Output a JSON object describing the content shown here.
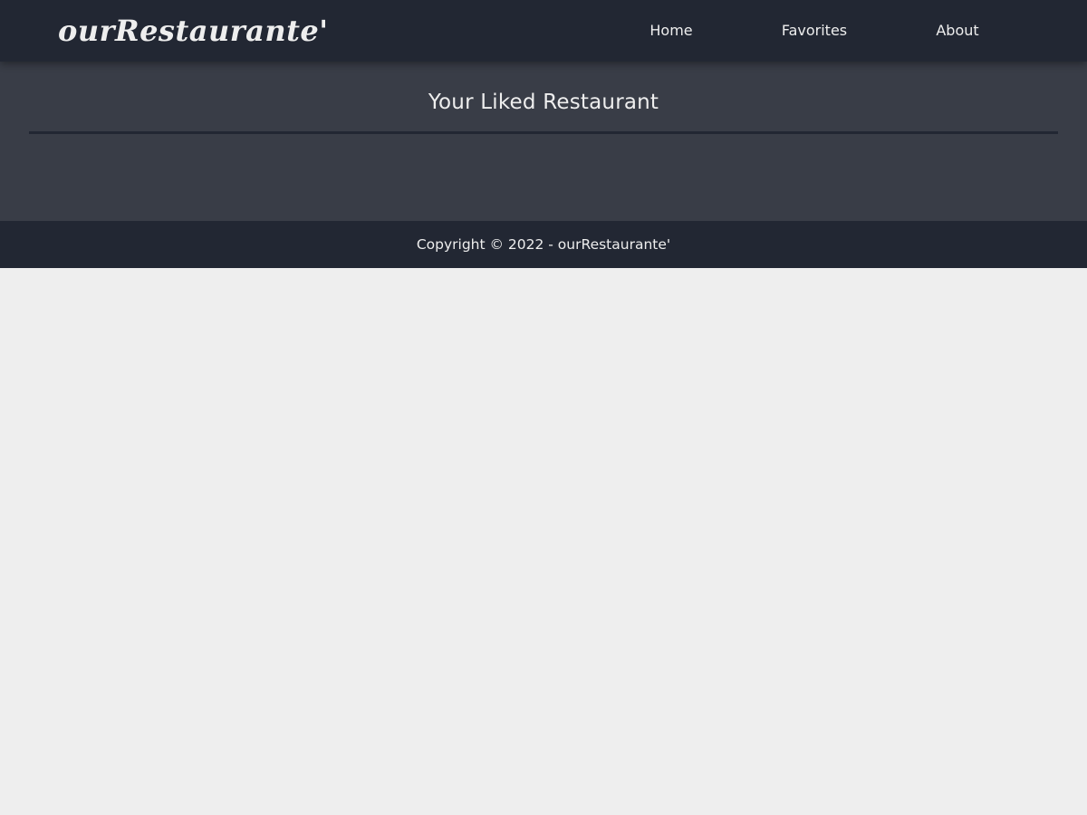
{
  "header": {
    "brand": "ourRestaurante'",
    "nav": [
      {
        "label": "Home"
      },
      {
        "label": "Favorites"
      },
      {
        "label": "About"
      }
    ]
  },
  "main": {
    "title": "Your Liked Restaurant",
    "restaurants": []
  },
  "footer": {
    "text": "Copyright © 2022 - ourRestaurante'"
  },
  "colors": {
    "navbar_bg": "#222733",
    "content_bg": "#393d47",
    "page_bg": "#eeeeee",
    "text": "#eeeeee"
  }
}
